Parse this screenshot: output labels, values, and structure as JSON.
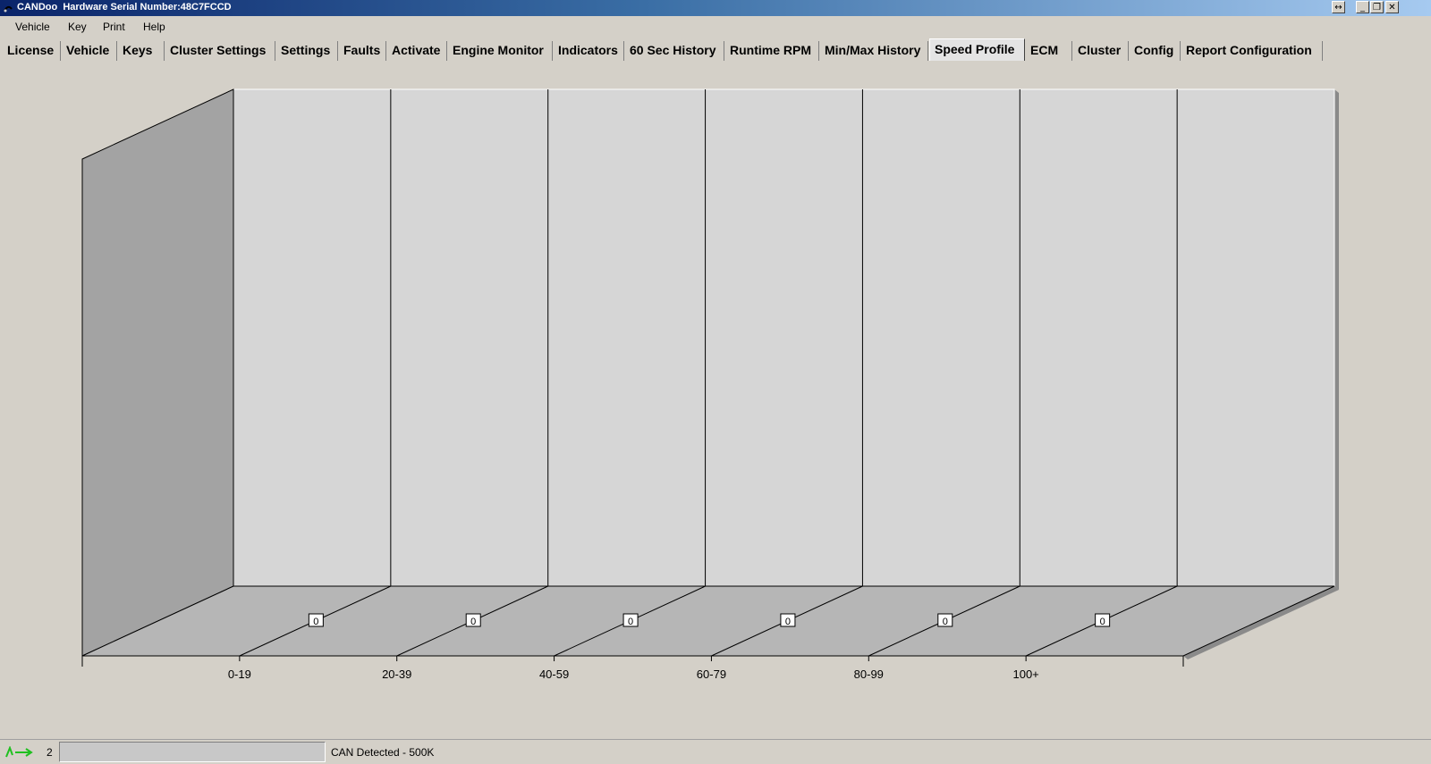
{
  "window": {
    "title": "CANDoo  Hardware Serial Number:48C7FCCD",
    "buttons": [
      "↔",
      "_",
      "❐",
      "✕"
    ]
  },
  "menu": [
    "Vehicle",
    "Key",
    "Print",
    "Help"
  ],
  "tabs": [
    {
      "label": "License"
    },
    {
      "label": "Vehicle"
    },
    {
      "label": "Keys"
    },
    {
      "label": "Cluster Settings"
    },
    {
      "label": "Settings"
    },
    {
      "label": "Faults"
    },
    {
      "label": "Activate"
    },
    {
      "label": "Engine Monitor"
    },
    {
      "label": "Indicators"
    },
    {
      "label": "60 Sec History"
    },
    {
      "label": "Runtime RPM"
    },
    {
      "label": "Min/Max History"
    },
    {
      "label": "Speed Profile",
      "active": true
    },
    {
      "label": "ECM"
    },
    {
      "label": "Cluster"
    },
    {
      "label": "Config"
    },
    {
      "label": "Report Configuration"
    }
  ],
  "chart_data": {
    "type": "bar",
    "style": "3d",
    "categories": [
      "0-19",
      "20-39",
      "40-59",
      "60-79",
      "80-99",
      "100+"
    ],
    "values": [
      0,
      0,
      0,
      0,
      0,
      0
    ],
    "data_labels": [
      "0",
      "0",
      "0",
      "0",
      "0",
      "0"
    ],
    "grid": true,
    "colors": {
      "wall": "#d6d6d6",
      "left_wall": "#a3a3a3",
      "floor": "#b6b6b6",
      "shadow": "#8a8a8a"
    }
  },
  "status": {
    "count": "2",
    "text": "CAN Detected - 500K",
    "icon": "can-connection-icon"
  }
}
